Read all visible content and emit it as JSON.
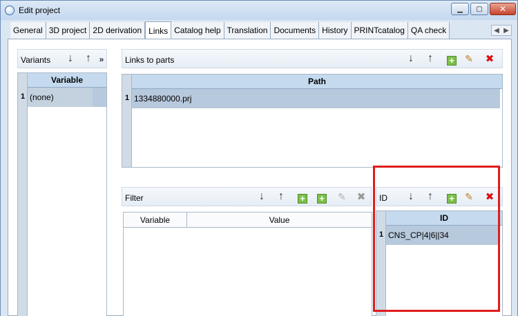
{
  "window": {
    "title": "Edit project"
  },
  "tabs": [
    "General",
    "3D project",
    "2D derivation",
    "Links",
    "Catalog help",
    "Translation",
    "Documents",
    "History",
    "PRINTcatalog",
    "QA check"
  ],
  "active_tab": "Links",
  "variants": {
    "label": "Variants",
    "column_header": "Variable",
    "rows": [
      {
        "num": "1",
        "value": "(none)"
      }
    ]
  },
  "links": {
    "label": "Links to parts",
    "column_header": "Path",
    "rows": [
      {
        "num": "1",
        "value": "1334880000.prj"
      }
    ]
  },
  "filter": {
    "label": "Filter",
    "columns": [
      "Variable",
      "Value"
    ]
  },
  "id_panel": {
    "label": "ID",
    "column_header": "ID",
    "rows": [
      {
        "num": "1",
        "value": "CNS_CP|4|6||34"
      }
    ]
  },
  "icons": {
    "down": "↓",
    "up": "↑",
    "expand": "»",
    "add": "+",
    "delete": "✖",
    "edit": "✎"
  },
  "colors": {
    "highlight": "#e01b1b",
    "header_bg": "#c5daef",
    "selected_row": "#b7c9dc"
  }
}
